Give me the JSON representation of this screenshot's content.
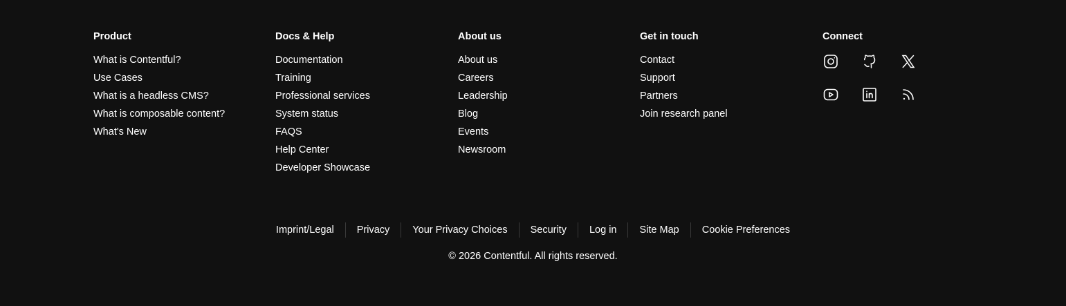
{
  "columns": {
    "product": {
      "title": "Product",
      "items": [
        "What is Contentful?",
        "Use Cases",
        "What is a headless CMS?",
        "What is composable content?",
        "What's New"
      ]
    },
    "docs": {
      "title": "Docs & Help",
      "items": [
        "Documentation",
        "Training",
        "Professional services",
        "System status",
        "FAQS",
        "Help Center",
        "Developer Showcase"
      ]
    },
    "about": {
      "title": "About us",
      "items": [
        "About us",
        "Careers",
        "Leadership",
        "Blog",
        "Events",
        "Newsroom"
      ]
    },
    "contact": {
      "title": "Get in touch",
      "items": [
        "Contact",
        "Support",
        "Partners",
        "Join research panel"
      ]
    },
    "connect": {
      "title": "Connect",
      "icons": [
        "instagram-icon",
        "github-icon",
        "x-icon",
        "youtube-icon",
        "linkedin-icon",
        "rss-icon"
      ]
    }
  },
  "legal_links": [
    "Imprint/Legal",
    "Privacy",
    "Your Privacy Choices",
    "Security",
    "Log in",
    "Site Map",
    "Cookie Preferences"
  ],
  "copyright": "© 2026 Contentful. All rights reserved.",
  "colors": {
    "background": "#111111",
    "text": "#ffffff",
    "separator": "#3a3a3a"
  }
}
